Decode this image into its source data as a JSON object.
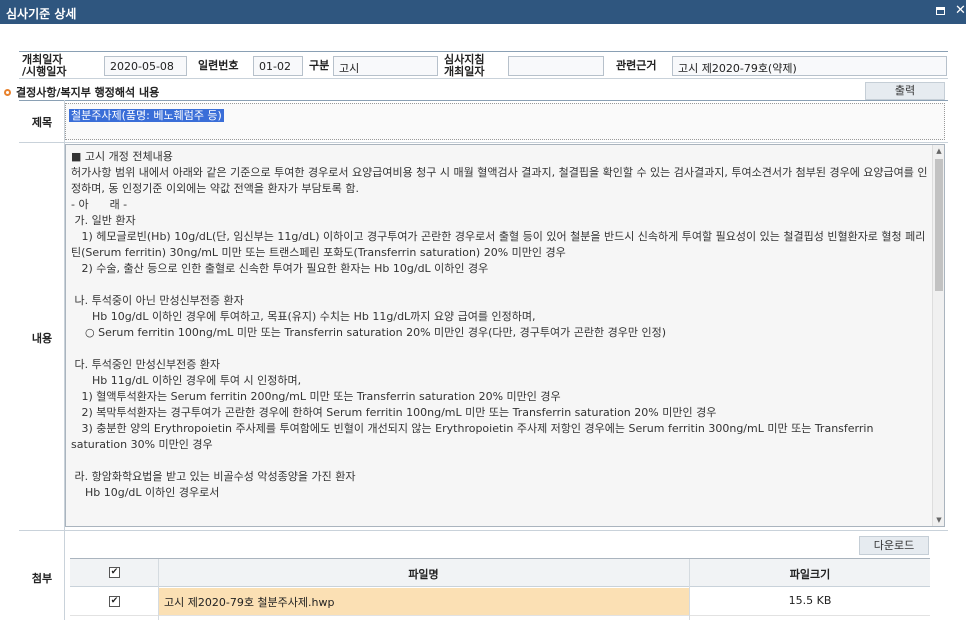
{
  "window": {
    "title": "심사기준 상세"
  },
  "info": {
    "date_label": "개최일자\n/시행일자",
    "date_value": "2020-05-08",
    "serial_label": "일련번호",
    "serial_value": "01-02",
    "category_label": "구분",
    "category_value": "고시",
    "review_label": "심사지침\n개최일자",
    "review_value": "",
    "basis_label": "관련근거",
    "basis_value": "고시 제2020-79호(약제)"
  },
  "section": {
    "heading": "결정사항/복지부 행정해석 내용",
    "print_label": "출력"
  },
  "title_row": {
    "label": "제목",
    "value": "철분주사제(품명: 베노훼럼주 등)"
  },
  "content_row": {
    "label": "내용",
    "text": "■ 고시 개정 전체내용\n허가사항 범위 내에서 아래와 같은 기준으로 투여한 경우로서 요양급여비용 청구 시 매월 혈액검사 결과지, 철결핍을 확인할 수 있는 검사결과지, 투여소견서가 첨부된 경우에 요양급여를 인정하며, 동 인정기준 이외에는 약값 전액을 환자가 부담토록 함.\n- 아      래 -\n 가. 일반 환자\n   1) 헤모글로빈(Hb) 10g/dL(단, 임신부는 11g/dL) 이하이고 경구투여가 곤란한 경우로서 출혈 등이 있어 철분을 반드시 신속하게 투여할 필요성이 있는 철결핍성 빈혈환자로 혈청 페리틴(Serum ferritin) 30ng/mL 미만 또는 트랜스페린 포화도(Transferrin saturation) 20% 미만인 경우\n   2) 수술, 출산 등으로 인한 출혈로 신속한 투여가 필요한 환자는 Hb 10g/dL 이하인 경우\n\n 나. 투석중이 아닌 만성신부전증 환자\n      Hb 10g/dL 이하인 경우에 투여하고, 목표(유지) 수치는 Hb 11g/dL까지 요양 급여를 인정하며,\n    ○ Serum ferritin 100ng/mL 미만 또는 Transferrin saturation 20% 미만인 경우(다만, 경구투여가 곤란한 경우만 인정)\n\n 다. 투석중인 만성신부전증 환자\n      Hb 11g/dL 이하인 경우에 투여 시 인정하며,\n   1) 혈액투석환자는 Serum ferritin 200ng/mL 미만 또는 Transferrin saturation 20% 미만인 경우\n   2) 복막투석환자는 경구투여가 곤란한 경우에 한하여 Serum ferritin 100ng/mL 미만 또는 Transferrin saturation 20% 미만인 경우\n   3) 충분한 양의 Erythropoietin 주사제를 투여함에도 빈혈이 개선되지 않는 Erythropoietin 주사제 저항인 경우에는 Serum ferritin 300ng/mL 미만 또는 Transferrin saturation 30% 미만인 경우\n\n 라. 항암화학요법을 받고 있는 비골수성 악성종양을 가진 환자\n    Hb 10g/dL 이하인 경우로서"
  },
  "attachments": {
    "label": "첨부",
    "download_label": "다운로드",
    "col_filename": "파일명",
    "col_filesize": "파일크기",
    "header_checked": true,
    "files": [
      {
        "name": "고시 제2020-79호 철분주사제.hwp",
        "size": "15.5 KB",
        "checked": true
      }
    ]
  },
  "colors": {
    "titlebar": "#2f567f",
    "selection": "#3a6ed8",
    "file_row": "#fbe0b4",
    "bullet": "#e8822e"
  }
}
